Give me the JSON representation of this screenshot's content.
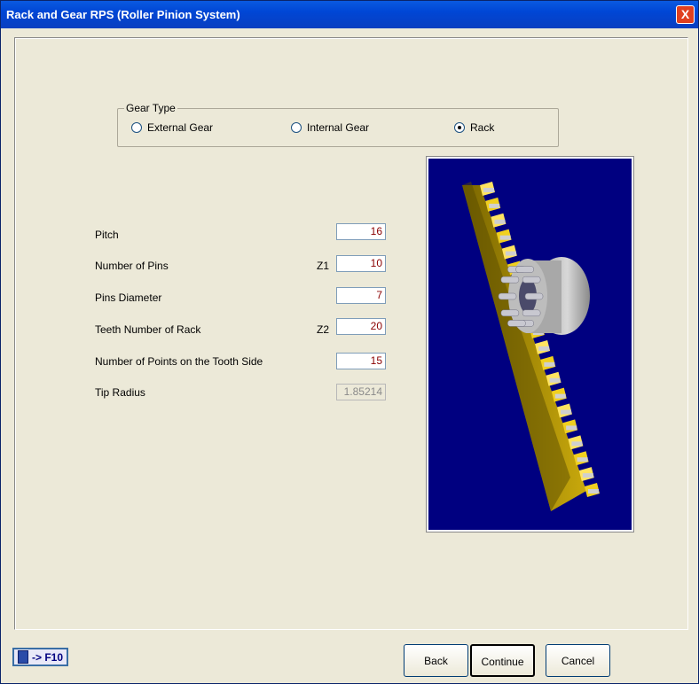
{
  "window": {
    "title": "Rack and Gear RPS (Roller Pinion System)",
    "close_label": "X"
  },
  "gear_type": {
    "legend": "Gear Type",
    "options": [
      {
        "label": "External Gear",
        "selected": false
      },
      {
        "label": "Internal Gear",
        "selected": false
      },
      {
        "label": "Rack",
        "selected": true
      }
    ]
  },
  "params": {
    "pitch": {
      "label": "Pitch",
      "value": "16"
    },
    "num_pins": {
      "label": "Number of Pins",
      "tag": "Z1",
      "value": "10"
    },
    "pins_diameter": {
      "label": "Pins Diameter",
      "value": "7"
    },
    "teeth_rack": {
      "label": "Teeth Number of Rack",
      "tag": "Z2",
      "value": "20"
    },
    "points_tooth_side": {
      "label": "Number of Points on the Tooth Side",
      "value": "15"
    },
    "tip_radius": {
      "label": "Tip Radius",
      "value": "1.85214"
    }
  },
  "shortcut": {
    "label": "-> F10",
    "icon": "calculator-icon"
  },
  "buttons": {
    "back": "Back",
    "continue": "Continue",
    "cancel": "Cancel"
  },
  "colors": {
    "preview_bg": "#000080",
    "value_text": "#8b0000",
    "rack": "#c8a800"
  }
}
